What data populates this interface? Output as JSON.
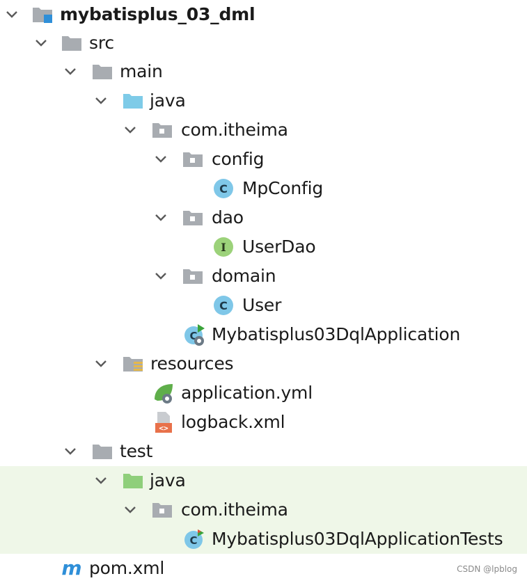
{
  "tree": [
    {
      "id": "root",
      "label": "mybatisplus_03_dml",
      "bold": true,
      "chevron": "expanded",
      "icon": "module-icon"
    },
    {
      "id": "src",
      "label": "src",
      "chevron": "expanded",
      "icon": "folder-icon"
    },
    {
      "id": "main",
      "label": "main",
      "chevron": "expanded",
      "icon": "folder-icon"
    },
    {
      "id": "java-main",
      "label": "java",
      "chevron": "expanded",
      "icon": "source-root-folder-icon"
    },
    {
      "id": "pkg-main",
      "label": "com.itheima",
      "chevron": "expanded",
      "icon": "package-icon"
    },
    {
      "id": "config",
      "label": "config",
      "chevron": "expanded",
      "icon": "package-icon"
    },
    {
      "id": "mpconfig",
      "label": "MpConfig",
      "chevron": "none",
      "icon": "class-icon"
    },
    {
      "id": "dao",
      "label": "dao",
      "chevron": "expanded",
      "icon": "package-icon"
    },
    {
      "id": "userdao",
      "label": "UserDao",
      "chevron": "none",
      "icon": "interface-icon"
    },
    {
      "id": "domain",
      "label": "domain",
      "chevron": "expanded",
      "icon": "package-icon"
    },
    {
      "id": "user",
      "label": "User",
      "chevron": "none",
      "icon": "class-icon"
    },
    {
      "id": "app",
      "label": "Mybatisplus03DqlApplication",
      "chevron": "none",
      "icon": "spring-boot-app-icon"
    },
    {
      "id": "resources",
      "label": "resources",
      "chevron": "expanded",
      "icon": "resources-folder-icon"
    },
    {
      "id": "appyml",
      "label": "application.yml",
      "chevron": "none",
      "icon": "spring-config-icon"
    },
    {
      "id": "logback",
      "label": "logback.xml",
      "chevron": "none",
      "icon": "xml-file-icon"
    },
    {
      "id": "test",
      "label": "test",
      "chevron": "expanded",
      "icon": "folder-icon"
    },
    {
      "id": "java-test",
      "label": "java",
      "chevron": "expanded",
      "icon": "test-root-folder-icon"
    },
    {
      "id": "pkg-test",
      "label": "com.itheima",
      "chevron": "expanded",
      "icon": "package-icon"
    },
    {
      "id": "apptests",
      "label": "Mybatisplus03DqlApplicationTests",
      "chevron": "none",
      "icon": "test-class-icon"
    },
    {
      "id": "pom",
      "label": "pom.xml",
      "chevron": "none",
      "icon": "maven-icon"
    }
  ],
  "watermark": "CSDN @lpblog",
  "colors": {
    "selection_bg": "#eff7e8",
    "folder_gray": "#a8acb1",
    "source_root_blue": "#7ecbe8",
    "test_root_green": "#8fcf7b",
    "class_blue": "#7fc7e8",
    "interface_green": "#9cd27a",
    "maven_blue": "#2f8fd8",
    "xml_orange": "#e8714a"
  }
}
